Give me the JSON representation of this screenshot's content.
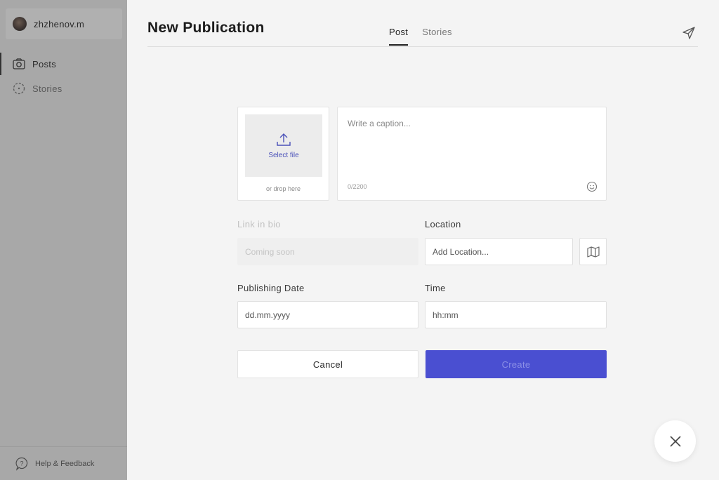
{
  "user": {
    "name": "zhzhenov.m"
  },
  "sidebar": {
    "items": [
      {
        "label": "Posts",
        "icon": "camera-icon",
        "active": true
      },
      {
        "label": "Stories",
        "icon": "stories-icon",
        "active": false
      }
    ],
    "help": {
      "label": "Help & Feedback",
      "icon": "help-icon"
    }
  },
  "header": {
    "title": "New Publication",
    "tabs": [
      {
        "label": "Post",
        "active": true
      },
      {
        "label": "Stories",
        "active": false
      }
    ],
    "send_icon": "send-icon"
  },
  "upload": {
    "label": "Select file",
    "hint": "or drop here",
    "icon": "upload-icon"
  },
  "caption": {
    "placeholder": "Write a caption...",
    "count": "0/2200",
    "emoji_icon": "emoji-icon"
  },
  "fields": {
    "link_in_bio": {
      "label": "Link in bio",
      "placeholder": "Coming soon",
      "disabled": true
    },
    "location": {
      "label": "Location",
      "placeholder": "Add Location...",
      "map_icon": "map-icon"
    },
    "publishing_date": {
      "label": "Publishing Date",
      "placeholder": "dd.mm.yyyy"
    },
    "time": {
      "label": "Time",
      "placeholder": "hh:mm"
    }
  },
  "actions": {
    "cancel": "Cancel",
    "create": "Create"
  },
  "close_icon": "close-icon",
  "colors": {
    "accent": "#4a4fd1",
    "sidebar": "#a8a8a8",
    "background": "#f4f4f4"
  }
}
